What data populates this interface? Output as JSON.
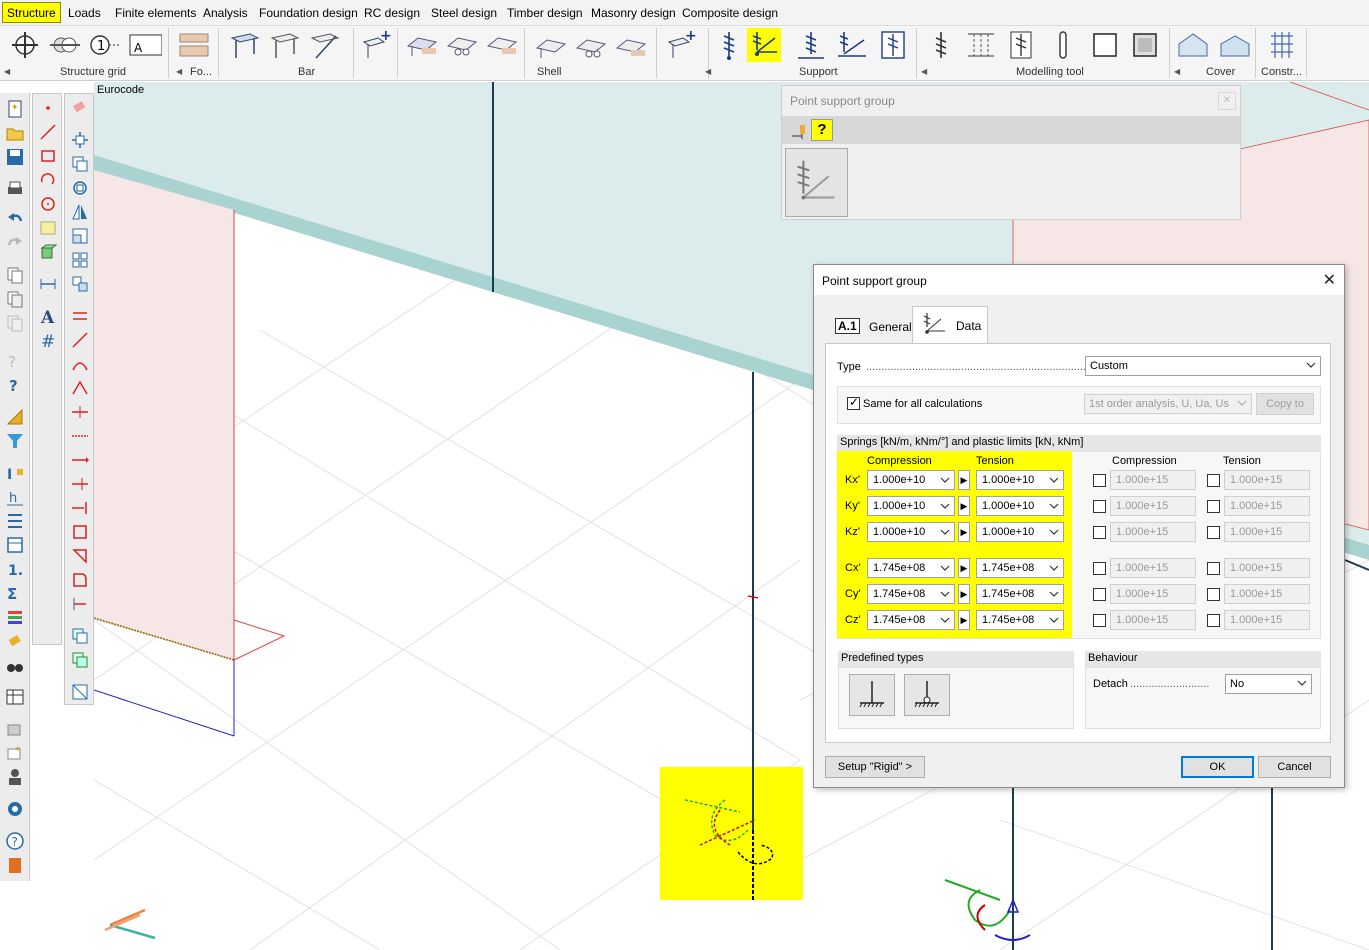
{
  "menu": [
    "Structure",
    "Loads",
    "Finite elements",
    "Analysis",
    "Foundation design",
    "RC design",
    "Steel design",
    "Timber design",
    "Masonry design",
    "Composite design"
  ],
  "ribbon_groups": {
    "structure_grid": "Structure grid",
    "fo": "Fo...",
    "bar": "Bar",
    "shell": "Shell",
    "support": "Support",
    "modelling_tool": "Modelling tool",
    "cover": "Cover",
    "constr": "Constr..."
  },
  "viewport": {
    "label": "Eurocode"
  },
  "psg_panel": {
    "title": "Point support group",
    "help": "?"
  },
  "dialog": {
    "title": "Point support group",
    "tabs": {
      "general_icon": "A.1",
      "general": "General",
      "data": "Data"
    },
    "type_label": "Type",
    "type_value": "Custom",
    "same_label": "Same for all calculations",
    "calc_value": "1st order analysis, U, Ua, Us",
    "copy_to": "Copy to",
    "springs_header": "Springs [kN/m, kNm/°] and plastic limits [kN, kNm]",
    "col_compression": "Compression",
    "col_tension": "Tension",
    "col_compression2": "Compression",
    "col_tension2": "Tension",
    "rows": [
      {
        "label": "Kx'",
        "comp": "1.000e+10",
        "tens": "1.000e+10",
        "pc": "1.000e+15",
        "pt": "1.000e+15"
      },
      {
        "label": "Ky'",
        "comp": "1.000e+10",
        "tens": "1.000e+10",
        "pc": "1.000e+15",
        "pt": "1.000e+15"
      },
      {
        "label": "Kz'",
        "comp": "1.000e+10",
        "tens": "1.000e+10",
        "pc": "1.000e+15",
        "pt": "1.000e+15"
      },
      {
        "label": "Cx'",
        "comp": "1.745e+08",
        "tens": "1.745e+08",
        "pc": "1.000e+15",
        "pt": "1.000e+15"
      },
      {
        "label": "Cy'",
        "comp": "1.745e+08",
        "tens": "1.745e+08",
        "pc": "1.000e+15",
        "pt": "1.000e+15"
      },
      {
        "label": "Cz'",
        "comp": "1.745e+08",
        "tens": "1.745e+08",
        "pc": "1.000e+15",
        "pt": "1.000e+15"
      }
    ],
    "predefined_title": "Predefined types",
    "behaviour_title": "Behaviour",
    "detach_label": "Detach",
    "detach_value": "No",
    "setup_rigid": "Setup \"Rigid\" >",
    "ok": "OK",
    "cancel": "Cancel"
  },
  "colors": {
    "highlight": "#ffff00",
    "slab": "#dcecec",
    "slab_edge": "#a9d3d1",
    "wall": "#f7e6e6",
    "column": "#1c3b4f"
  }
}
